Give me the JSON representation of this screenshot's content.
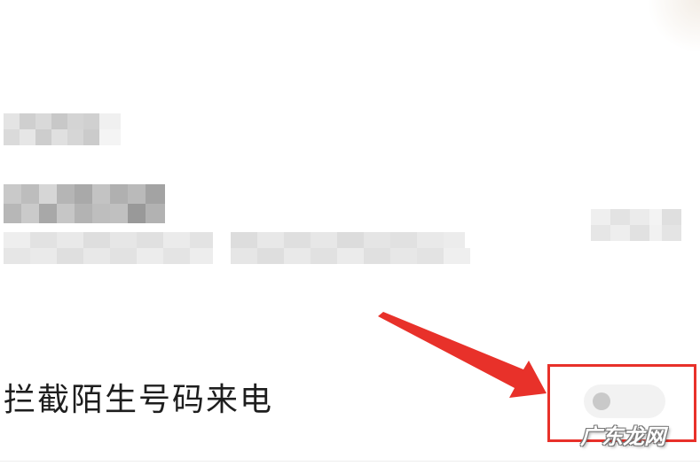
{
  "setting": {
    "label": "拦截陌生号码来电",
    "toggle_state": "off"
  },
  "annotation": {
    "highlight_color": "#e8312a",
    "arrow_color": "#e8312a"
  },
  "watermark": {
    "text": "广东龙网"
  },
  "icons": {
    "toggle_knob": "toggle-knob-icon"
  }
}
